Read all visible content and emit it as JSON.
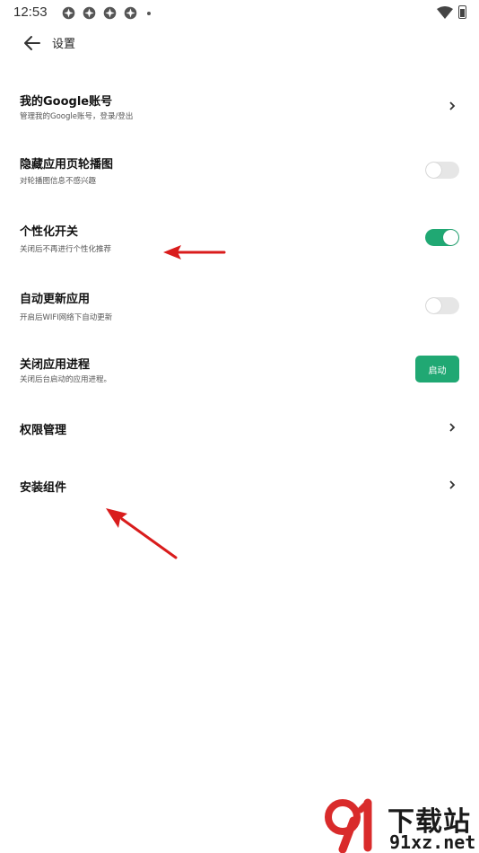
{
  "status_bar": {
    "time": "12:53",
    "icons": [
      "settings-notification-icon",
      "settings-notification-icon",
      "settings-notification-icon",
      "settings-notification-icon"
    ],
    "right_icons": [
      "wifi-icon",
      "battery-icon"
    ]
  },
  "app_bar": {
    "title": "设置"
  },
  "settings": {
    "google_account": {
      "title": "我的Google账号",
      "subtitle": "管理我的Google账号，登录/登出"
    },
    "hide_carousel": {
      "title": "隐藏应用页轮播图",
      "subtitle": "对轮播图信息不感兴趣",
      "enabled": false
    },
    "personalization": {
      "title": "个性化开关",
      "subtitle": "关闭后不再进行个性化推荐",
      "enabled": true
    },
    "auto_update": {
      "title": "自动更新应用",
      "subtitle": "开启后WIFI网络下自动更新",
      "enabled": false
    },
    "close_process": {
      "title": "关闭应用进程",
      "subtitle": "关闭后台启动的应用进程。",
      "button_label": "启动"
    },
    "permissions": {
      "title": "权限管理"
    },
    "install_components": {
      "title": "安装组件"
    }
  },
  "colors": {
    "accent": "#20a873",
    "annotation_arrow": "#d91c1c"
  },
  "watermark": {
    "brand": "下载站",
    "url": "91xz.net"
  }
}
